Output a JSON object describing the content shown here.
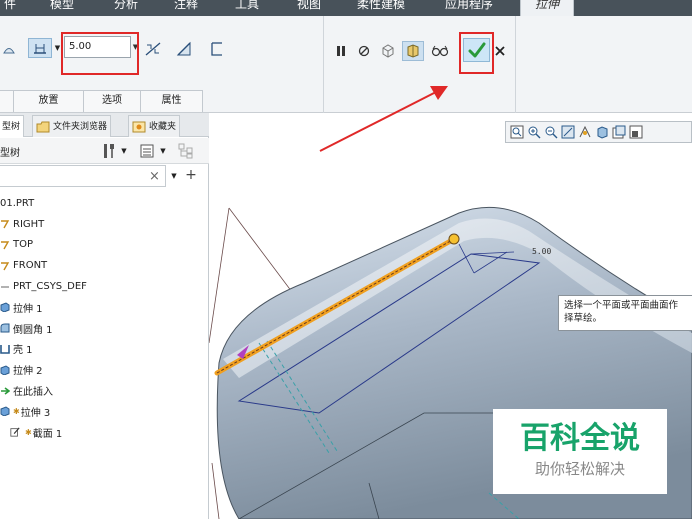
{
  "ribbon_tabs": {
    "file_partial": "件",
    "model": "模型",
    "analysis": "分析",
    "annotate": "注释",
    "tools": "工具",
    "view": "视图",
    "flexible_modeling": "柔性建模",
    "applications": "应用程序",
    "extrude": "拉伸"
  },
  "extrude_dashboard": {
    "depth_value": "5.00",
    "subtabs": [
      "放置",
      "选项",
      "属性"
    ]
  },
  "panel_tabs": {
    "model_tree_partial": "型树",
    "folder_browser": "文件夹浏览器",
    "favorites": "收藏夹"
  },
  "model_tree": {
    "header_partial": "型树",
    "filter_clear": "×",
    "items": [
      "01.PRT",
      "RIGHT",
      "TOP",
      "FRONT",
      "PRT_CSYS_DEF",
      "拉伸 1",
      "倒圆角 1",
      "壳 1",
      "拉伸 2",
      "在此插入",
      "拉伸 3",
      "截面 1"
    ]
  },
  "graphics": {
    "dimension_label": "5.00",
    "tooltip_line1": "选择一个平面或平面曲面作",
    "tooltip_line2": "择草绘。"
  },
  "watermark": {
    "line1": "百科全说",
    "line2": "助你轻松解决"
  },
  "colors": {
    "ribbon_dark": "#48525a",
    "highlight_red": "#e02828",
    "edge_orange": "#f0a020",
    "ok_green": "#2a9a3a",
    "watermark_green": "#18a36a"
  }
}
